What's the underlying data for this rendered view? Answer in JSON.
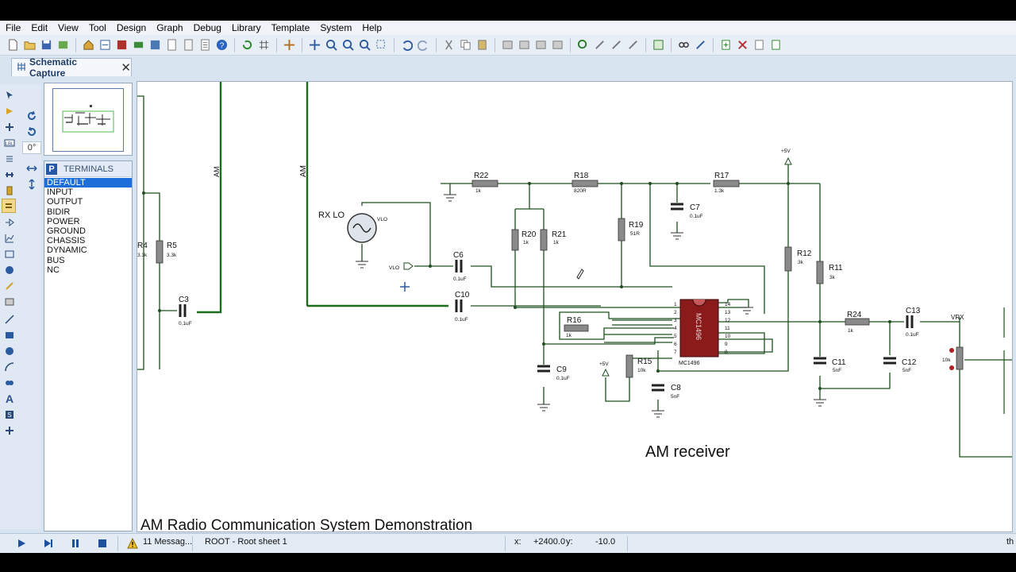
{
  "menu": [
    "File",
    "Edit",
    "View",
    "Tool",
    "Design",
    "Graph",
    "Debug",
    "Library",
    "Template",
    "System",
    "Help"
  ],
  "tab": {
    "label": "Schematic Capture",
    "close": "✕"
  },
  "left_tools": {
    "angle_value": "0°"
  },
  "selector": {
    "mode_icon": "P",
    "title": "TERMINALS",
    "items": [
      "DEFAULT",
      "INPUT",
      "OUTPUT",
      "BIDIR",
      "POWER",
      "GROUND",
      "CHASSIS",
      "DYNAMIC",
      "BUS",
      "NC"
    ],
    "selected_index": 0
  },
  "schematic": {
    "caption": "AM Radio Communication System Demonstration",
    "title": "AM receiver",
    "net_labels": {
      "am_left": "AM",
      "am_mid": "AM",
      "vlo": "VLO",
      "vlo_src": "VLO",
      "vrx": "VRX",
      "plus5_top": "+5V",
      "plus5_mid": "+5V"
    },
    "rx_lo": "RX LO",
    "components": [
      {
        "ref": "R22",
        "value": "1k"
      },
      {
        "ref": "R18",
        "value": "820R"
      },
      {
        "ref": "R17",
        "value": "1.3k"
      },
      {
        "ref": "C7",
        "value": "0.1uF"
      },
      {
        "ref": "R20",
        "value": "1k"
      },
      {
        "ref": "R21",
        "value": "1k"
      },
      {
        "ref": "R19",
        "value": "51R"
      },
      {
        "ref": "R12",
        "value": "3k"
      },
      {
        "ref": "R11",
        "value": "3k"
      },
      {
        "ref": "C6",
        "value": "0.1uF"
      },
      {
        "ref": "C10",
        "value": "0.1uF"
      },
      {
        "ref": "R16",
        "value": "1k"
      },
      {
        "ref": "C9",
        "value": "0.1uF"
      },
      {
        "ref": "R15",
        "value": "10k"
      },
      {
        "ref": "C8",
        "value": "5nF"
      },
      {
        "ref": "R24",
        "value": "1k"
      },
      {
        "ref": "C13",
        "value": "0.1uF"
      },
      {
        "ref": "C11",
        "value": "5nF"
      },
      {
        "ref": "C12",
        "value": "5nF"
      },
      {
        "ref": "R4",
        "value": "3.3k"
      },
      {
        "ref": "R5",
        "value": "3.3k"
      },
      {
        "ref": "C3",
        "value": "0.1uF"
      }
    ],
    "ic": {
      "ref": "MC1496",
      "body_label": "MC1496",
      "pins_left": [
        "1",
        "2",
        "3",
        "4",
        "5",
        "6",
        "7"
      ],
      "pins_right": [
        "14",
        "13",
        "12",
        "11",
        "10",
        "9",
        "8"
      ]
    },
    "pot_value": "10k"
  },
  "status": {
    "messages": "11 Messag...",
    "sheet": "ROOT - Root sheet 1",
    "x_label": "x:",
    "x_value": "+2400.0",
    "y_label": "y:",
    "y_value": "-10.0",
    "trailing": "th"
  },
  "colors": {
    "wire": "#1f4f1f",
    "component": "#8a8a8a",
    "ic_body": "#8b1a1a",
    "ground": "#333333"
  }
}
